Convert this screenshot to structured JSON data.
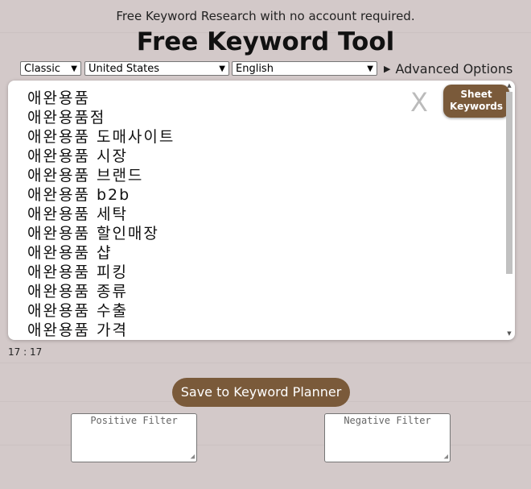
{
  "header": {
    "tagline": "Free Keyword Research with no account required.",
    "title": "Free Keyword Tool"
  },
  "options": {
    "mode": "Classic",
    "country": "United States",
    "language": "English",
    "advanced_label": "Advanced Options"
  },
  "keywords": [
    "애완용품",
    "애완용품점",
    "애완용품 도매사이트",
    "애완용품 시장",
    "애완용품 브랜드",
    "애완용품 b2b",
    "애완용품 세탁",
    "애완용품 할인매장",
    "애완용품 샵",
    "애완용품 피킹",
    "애완용품 종류",
    "애완용품 수출",
    "애완용품 가격"
  ],
  "kwbox": {
    "close_glyph": "X",
    "sheet_button": "Sheet Keywords"
  },
  "counter": "17 : 17",
  "actions": {
    "save_label": "Save to Keyword Planner"
  },
  "filters": {
    "positive_placeholder": "Positive Filter",
    "negative_placeholder": "Negative Filter"
  },
  "colors": {
    "background": "#d3c9c9",
    "accent": "#7a5a3a"
  }
}
